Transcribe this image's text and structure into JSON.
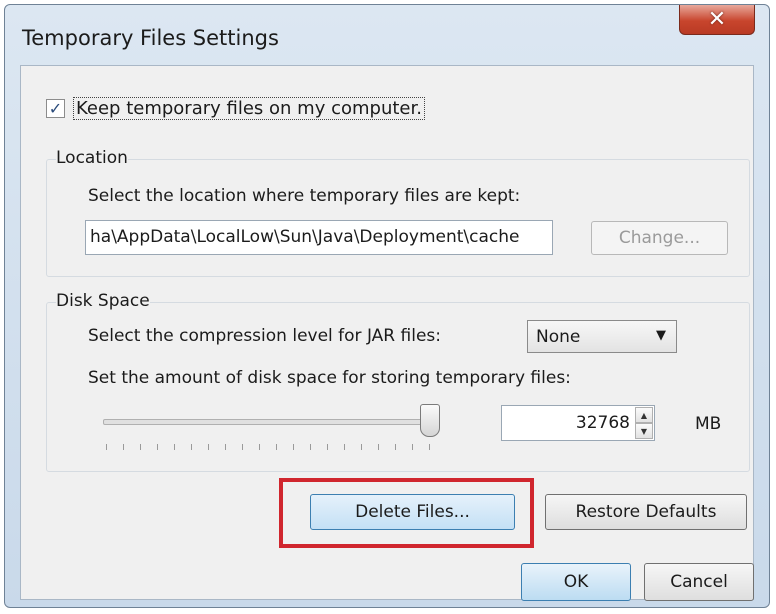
{
  "window": {
    "title": "Temporary Files Settings",
    "close_glyph": "✕"
  },
  "keep_files": {
    "checked": true,
    "check_glyph": "✓",
    "label": "Keep temporary files on my computer."
  },
  "location": {
    "title": "Location",
    "prompt": "Select the location where temporary files are kept:",
    "path": "ha\\AppData\\LocalLow\\Sun\\Java\\Deployment\\cache",
    "change_label": "Change..."
  },
  "disk_space": {
    "title": "Disk Space",
    "compression_prompt": "Select the compression level for JAR files:",
    "compression_value": "None",
    "dropdown_glyph": "▼",
    "amount_prompt": "Set the amount of disk space for storing temporary files:",
    "slider_level": 1.0,
    "amount_value": "32768",
    "spin_up": "▲",
    "spin_down": "▼",
    "unit": "MB"
  },
  "actions": {
    "delete_label": "Delete Files...",
    "restore_label": "Restore Defaults"
  },
  "footer": {
    "ok_label": "OK",
    "cancel_label": "Cancel"
  },
  "colors": {
    "highlight": "#d0262e",
    "close": "#c8452d"
  }
}
